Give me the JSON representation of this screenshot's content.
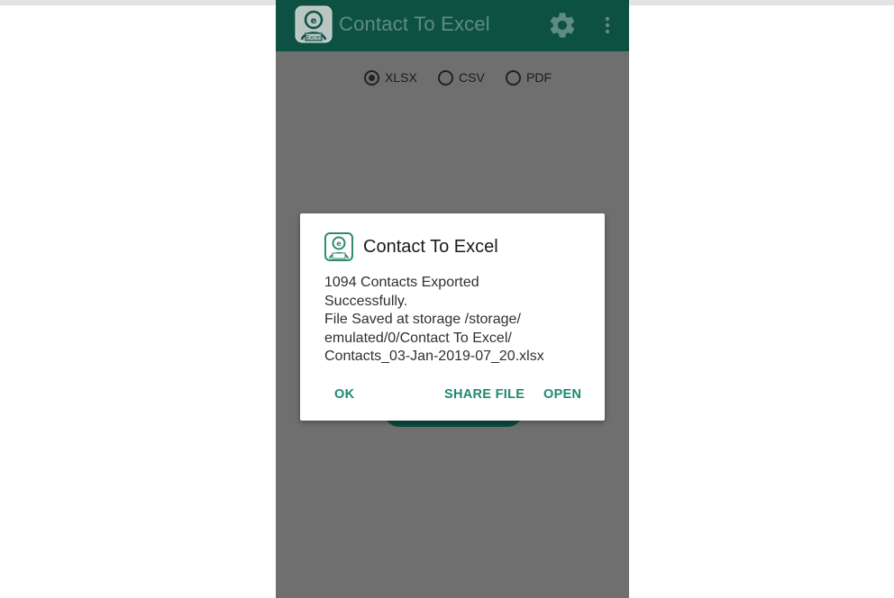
{
  "app_bar": {
    "title": "Contact To Excel",
    "icon": "contact-excel-app-icon",
    "settings_icon": "gear-icon",
    "menu_icon": "more-vert-icon"
  },
  "export_format": {
    "options": [
      "XLSX",
      "CSV",
      "PDF"
    ],
    "selected": "XLSX"
  },
  "dialog": {
    "title": "Contact To Excel",
    "message_lines": [
      "1094 Contacts Exported",
      "Successfully.",
      "File Saved at storage /storage/",
      "emulated/0/Contact To Excel/",
      "Contacts_03-Jan-2019-07_20.xlsx"
    ],
    "buttons": {
      "ok": "OK",
      "share": "SHARE FILE",
      "open": "OPEN"
    }
  },
  "colors": {
    "app_bar": "#0d5143",
    "app_title": "#5f8c82",
    "scrim": "#6f6f6f",
    "dialog_button": "#1e8a6e",
    "icon_green": "#2e8b6d"
  }
}
